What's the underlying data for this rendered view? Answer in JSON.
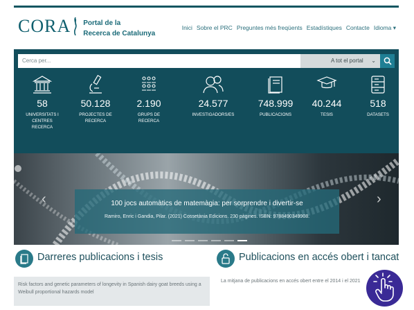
{
  "header": {
    "logo_word": "CORA",
    "logo_sub_line1": "Portal de la",
    "logo_sub_line2": "Recerca de Catalunya",
    "nav": [
      "Inici",
      "Sobre el PRC",
      "Preguntes més freqüents",
      "Estadístiques",
      "Contacte",
      "Idioma ▾"
    ]
  },
  "search": {
    "placeholder": "Cerca per...",
    "scope": "A tot el portal"
  },
  "stats": [
    {
      "icon": "university-icon",
      "value": "58",
      "label": "Universitats i centres recerca"
    },
    {
      "icon": "microscope-icon",
      "value": "50.128",
      "label": "Projectes de recerca"
    },
    {
      "icon": "groups-icon",
      "value": "2.190",
      "label": "Grups de recerca"
    },
    {
      "icon": "researchers-icon",
      "value": "24.577",
      "label": "Investigadors/es"
    },
    {
      "icon": "publications-icon",
      "value": "748.999",
      "label": "Publicacions"
    },
    {
      "icon": "graduation-cap-icon",
      "value": "40.244",
      "label": "Tesis"
    },
    {
      "icon": "database-icon",
      "value": "518",
      "label": "Datasets"
    }
  ],
  "hero": {
    "title": "100 jocs automàtics de matemàgia: per sorprendre i divertir-se",
    "subtitle": "Ramiro, Enric i Gandia, Pilar. (2021) Cossetània Edicions. 230 pàgines. ISBN: 9788490349908."
  },
  "sections": {
    "latest_title": "Darreres publicacions i tesis",
    "latest_item": "Risk factors and genetic parameters of longevity in Spanish dairy goat breeds using a Weibull proportional hazards model",
    "open_title": "Publicacions en accés obert i tancat",
    "open_text": "La mitjana de publicacions en accés obert entre el 2014 i el 2021"
  },
  "colors": {
    "primary": "#124d5b",
    "accent": "#1f7f94",
    "hand_badge": "#3a2a96"
  }
}
